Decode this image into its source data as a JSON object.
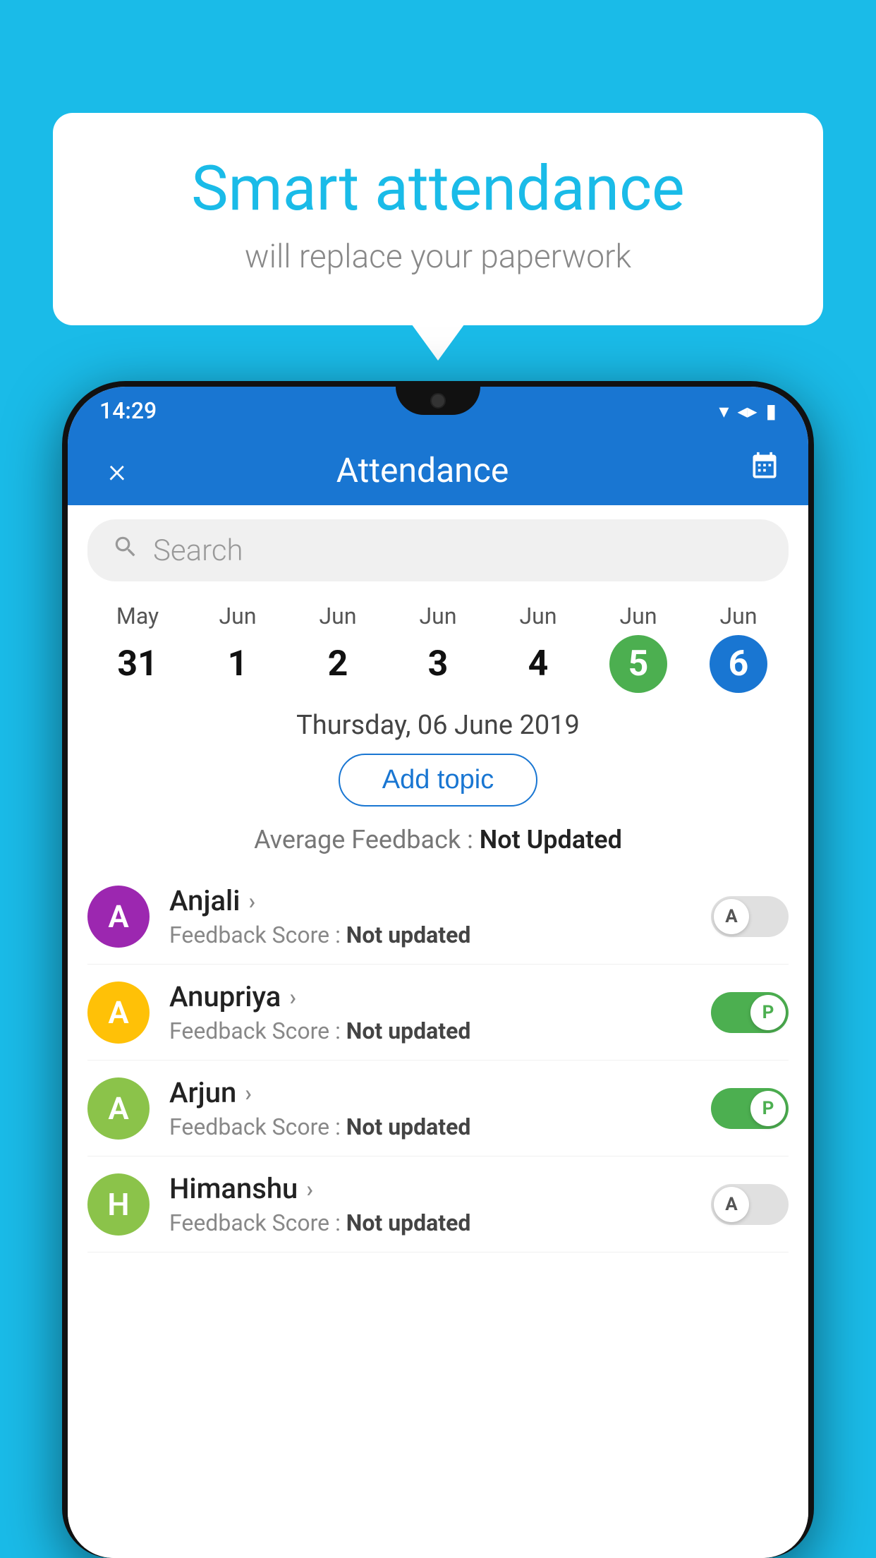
{
  "background_color": "#1ABBE8",
  "speech_bubble": {
    "title": "Smart attendance",
    "subtitle": "will replace your paperwork"
  },
  "status_bar": {
    "time": "14:29",
    "icons": [
      "wifi",
      "signal",
      "battery"
    ]
  },
  "app_header": {
    "close_label": "×",
    "title": "Attendance",
    "calendar_icon": "📅"
  },
  "search": {
    "placeholder": "Search"
  },
  "calendar": {
    "days": [
      {
        "month": "May",
        "date": "31",
        "state": "normal"
      },
      {
        "month": "Jun",
        "date": "1",
        "state": "normal"
      },
      {
        "month": "Jun",
        "date": "2",
        "state": "normal"
      },
      {
        "month": "Jun",
        "date": "3",
        "state": "normal"
      },
      {
        "month": "Jun",
        "date": "4",
        "state": "normal"
      },
      {
        "month": "Jun",
        "date": "5",
        "state": "today"
      },
      {
        "month": "Jun",
        "date": "6",
        "state": "selected"
      }
    ]
  },
  "selected_date": "Thursday, 06 June 2019",
  "add_topic_label": "Add topic",
  "average_feedback_label": "Average Feedback :",
  "average_feedback_value": "Not Updated",
  "students": [
    {
      "name": "Anjali",
      "initial": "A",
      "avatar_color": "#9C27B0",
      "feedback_label": "Feedback Score :",
      "feedback_value": "Not updated",
      "toggle": "off",
      "toggle_label": "A"
    },
    {
      "name": "Anupriya",
      "initial": "A",
      "avatar_color": "#FFC107",
      "feedback_label": "Feedback Score :",
      "feedback_value": "Not updated",
      "toggle": "on",
      "toggle_label": "P"
    },
    {
      "name": "Arjun",
      "initial": "A",
      "avatar_color": "#8BC34A",
      "feedback_label": "Feedback Score :",
      "feedback_value": "Not updated",
      "toggle": "on",
      "toggle_label": "P"
    },
    {
      "name": "Himanshu",
      "initial": "H",
      "avatar_color": "#8BC34A",
      "feedback_label": "Feedback Score :",
      "feedback_value": "Not updated",
      "toggle": "off",
      "toggle_label": "A"
    }
  ]
}
